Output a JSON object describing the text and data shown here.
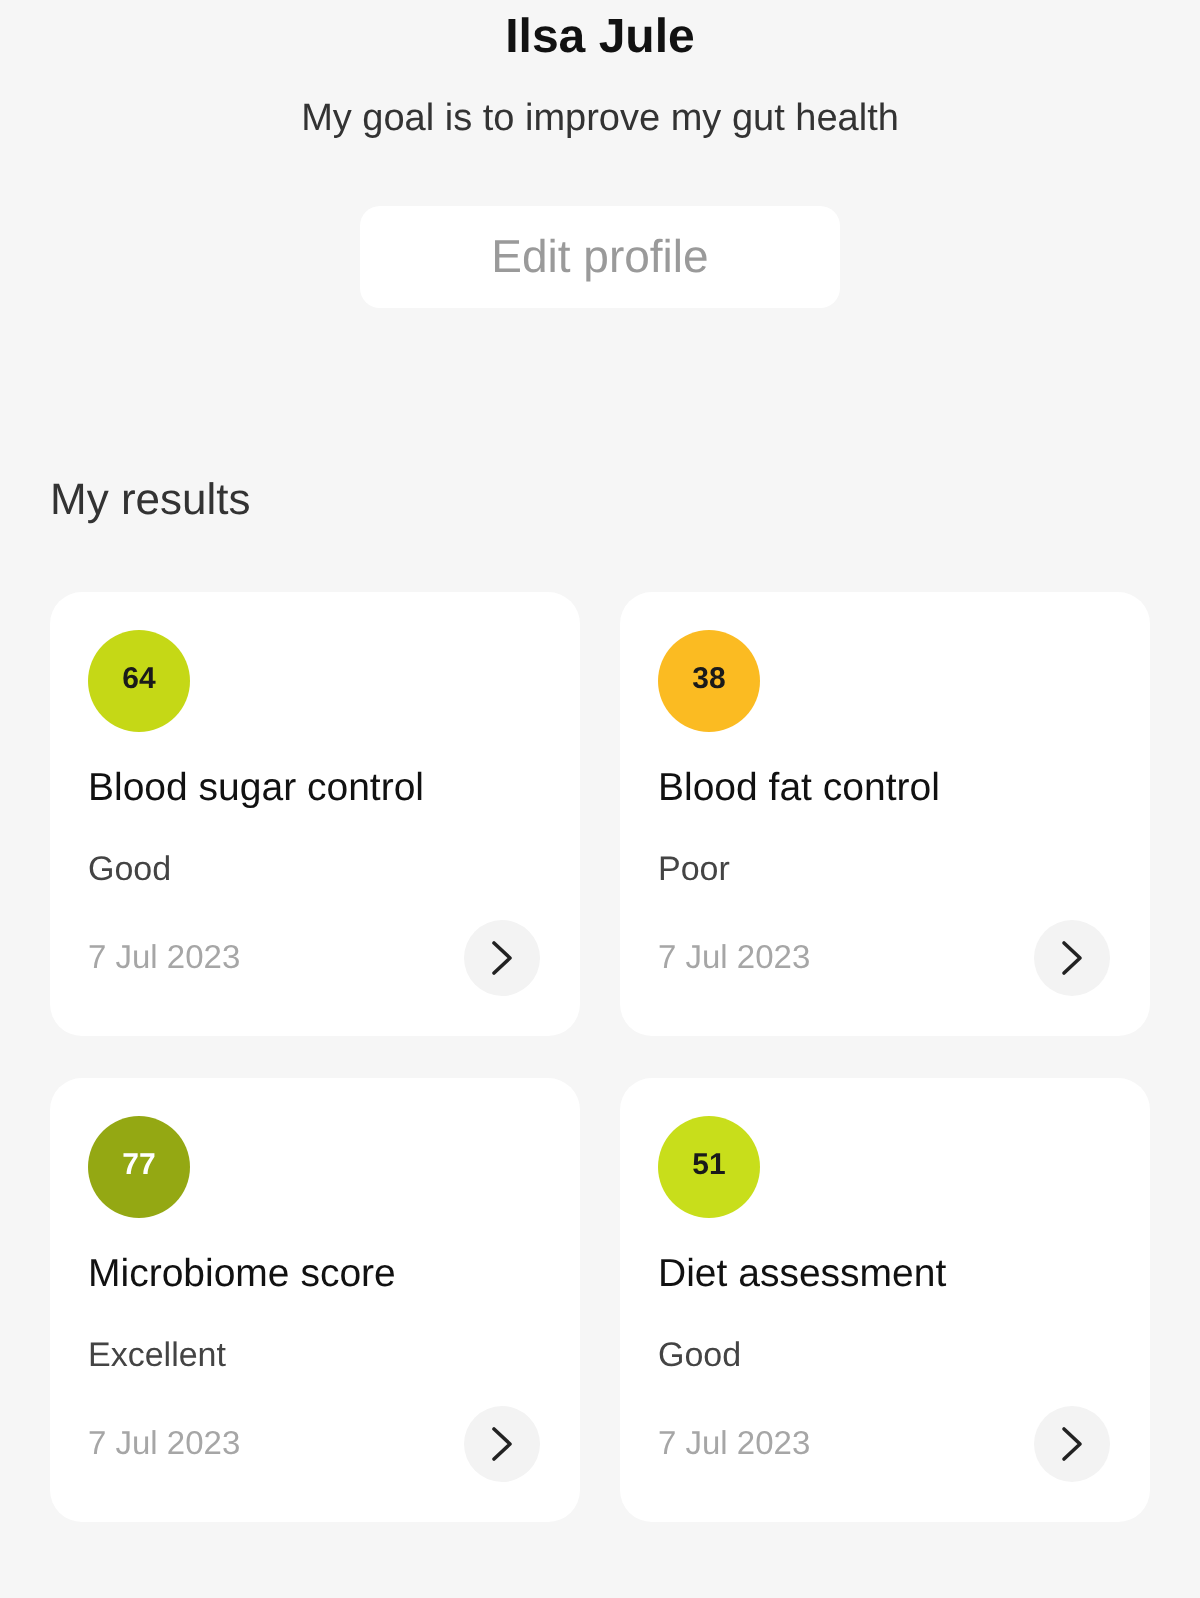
{
  "profile": {
    "name": "Ilsa Jule",
    "goal": "My goal is to improve my gut health"
  },
  "edit_button": {
    "label": "Edit profile"
  },
  "results_section": {
    "title": "My results"
  },
  "results": [
    {
      "score": "64",
      "color": "#c5d816",
      "title": "Blood sugar control",
      "rating": "Good",
      "date": "7 Jul 2023"
    },
    {
      "score": "38",
      "color": "#fbbb22",
      "title": "Blood fat control",
      "rating": "Poor",
      "date": "7 Jul 2023"
    },
    {
      "score": "77",
      "color": "#94a813",
      "title": "Microbiome score",
      "rating": "Excellent",
      "date": "7 Jul 2023"
    },
    {
      "score": "51",
      "color": "#c8de1b",
      "title": "Diet assessment",
      "rating": "Good",
      "date": "7 Jul 2023"
    }
  ]
}
